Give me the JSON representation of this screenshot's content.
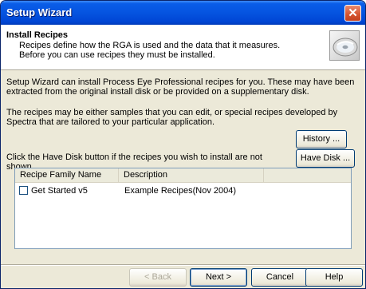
{
  "window": {
    "title": "Setup Wizard"
  },
  "header": {
    "title": "Install Recipes",
    "description": "Recipes define how the RGA is used and the data that it measures.  Before you can use recipes they must be installed."
  },
  "body": {
    "para1": "Setup Wizard can install Process Eye Professional recipes for you.  These may have been extracted from the original install disk or be provided on a supplementary disk.",
    "para2": "The recipes may be either samples that you can edit, or special recipes developed by Spectra that are tailored to your particular application.",
    "para3": "Click the Have Disk button if the recipes you wish to install are not shown."
  },
  "buttons": {
    "history": "History ...",
    "have_disk": "Have Disk ...",
    "back": "< Back",
    "next": "Next >",
    "cancel": "Cancel",
    "help": "Help"
  },
  "table": {
    "columns": [
      "Recipe Family Name",
      "Description"
    ],
    "rows": [
      {
        "name": "Get Started v5",
        "description": "Example Recipes(Nov 2004)",
        "checked": false
      }
    ]
  },
  "icons": {
    "close": "close-icon",
    "header_image": "cd-disk-icon",
    "checkbox": "checkbox-icon"
  }
}
